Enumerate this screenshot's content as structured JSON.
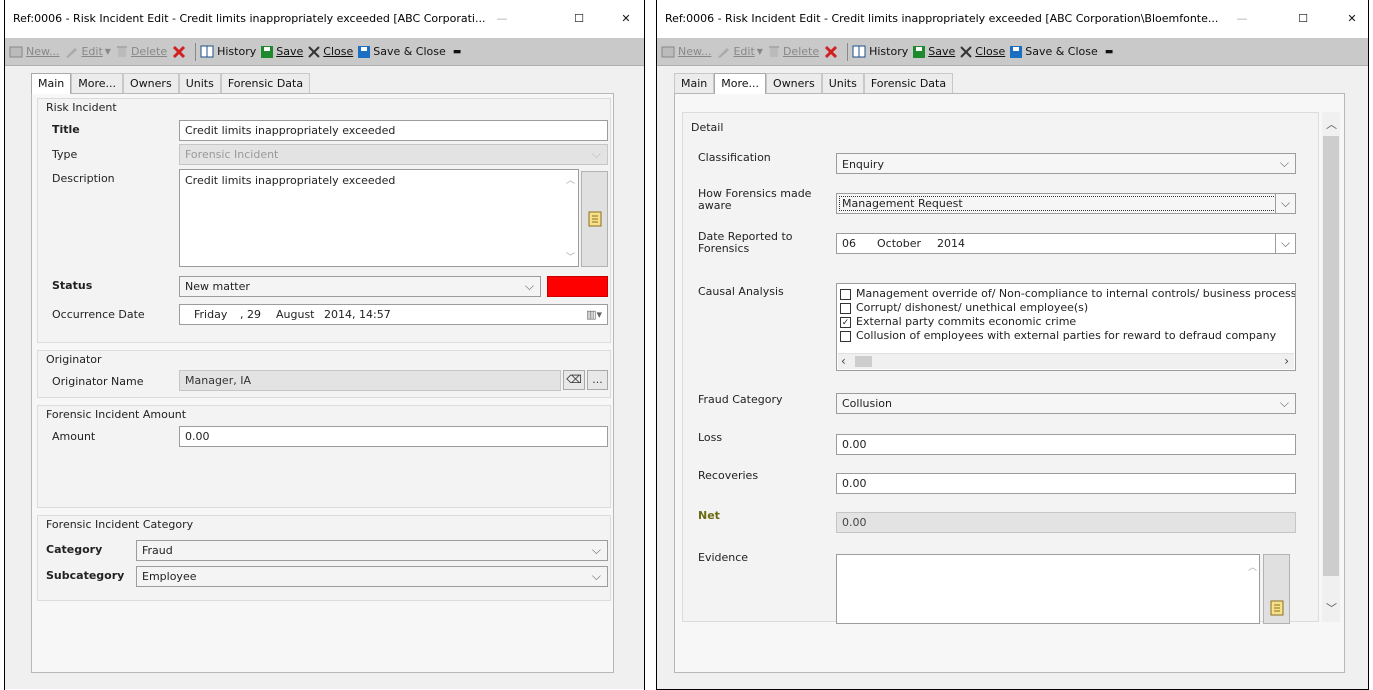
{
  "left_window": {
    "title": "Ref:0006 - Risk Incident Edit - Credit limits inappropriately exceeded [ABC Corporati...",
    "toolbar": {
      "new": "New...",
      "edit": "Edit",
      "delete": "Delete",
      "history": "History",
      "save": "Save",
      "close": "Close",
      "save_close": "Save & Close"
    },
    "tabs": [
      "Main",
      "More...",
      "Owners",
      "Units",
      "Forensic Data"
    ],
    "active_tab": "Main",
    "risk_incident": {
      "group_title": "Risk Incident",
      "title_label": "Title",
      "title_value": "Credit limits inappropriately exceeded",
      "type_label": "Type",
      "type_value": "Forensic Incident",
      "description_label": "Description",
      "description_value": "Credit limits inappropriately exceeded",
      "status_label": "Status",
      "status_value": "New matter",
      "status_color": "#ff0000",
      "occurrence_label": "Occurrence Date",
      "occurrence_day": "Friday",
      "occurrence_date": ", 29",
      "occurrence_month": "August",
      "occurrence_year_time": "2014, 14:57"
    },
    "originator": {
      "group_title": "Originator",
      "name_label": "Originator Name",
      "name_value": "Manager, IA",
      "browse_label": "..."
    },
    "amount": {
      "group_title": "Forensic Incident Amount",
      "label": "Amount",
      "value": "0.00"
    },
    "category": {
      "group_title": "Forensic Incident Category",
      "category_label": "Category",
      "category_value": "Fraud",
      "subcategory_label": "Subcategory",
      "subcategory_value": "Employee"
    }
  },
  "right_window": {
    "title": "Ref:0006 - Risk Incident Edit - Credit limits inappropriately exceeded [ABC Corporation\\Bloemfonte...",
    "toolbar": {
      "new": "New...",
      "edit": "Edit",
      "delete": "Delete",
      "history": "History",
      "save": "Save",
      "close": "Close",
      "save_close": "Save & Close"
    },
    "tabs": [
      "Main",
      "More...",
      "Owners",
      "Units",
      "Forensic Data"
    ],
    "active_tab": "More...",
    "detail": {
      "group_title": "Detail",
      "classification_label": "Classification",
      "classification_value": "Enquiry",
      "aware_label": "How Forensics made aware",
      "aware_value": "Management Request",
      "date_reported_label": "Date Reported to Forensics",
      "date_reported_day": "06",
      "date_reported_month": "October",
      "date_reported_year": "2014",
      "causal_label": "Causal Analysis",
      "causal_items": [
        {
          "label": "Management override of/ Non-compliance to internal controls/ business processes",
          "checked": false
        },
        {
          "label": "Corrupt/ dishonest/ unethical employee(s)",
          "checked": false
        },
        {
          "label": "External party commits economic crime",
          "checked": true
        },
        {
          "label": "Collusion of employees with external parties for reward to defraud company",
          "checked": false
        }
      ],
      "fraud_category_label": "Fraud Category",
      "fraud_category_value": "Collusion",
      "loss_label": "Loss",
      "loss_value": "0.00",
      "recoveries_label": "Recoveries",
      "recoveries_value": "0.00",
      "net_label": "Net",
      "net_value": "0.00",
      "evidence_label": "Evidence",
      "evidence_value": ""
    }
  },
  "icons": {
    "window_controls": [
      "minimize-icon",
      "maximize-icon",
      "close-icon"
    ],
    "toolbar": [
      "new-icon",
      "edit-pencil-icon",
      "delete-trash-icon",
      "delete-x-icon",
      "history-book-icon",
      "save-disk-icon",
      "close-x-icon",
      "save-close-disk-icon"
    ]
  },
  "colors": {
    "toolbar_bg": "#c9c9c9",
    "delete_x": "#d21f1f",
    "save_disk": "#1b6fc2",
    "status_swatch": "#ff0000",
    "net_label": "#6b6b10"
  }
}
